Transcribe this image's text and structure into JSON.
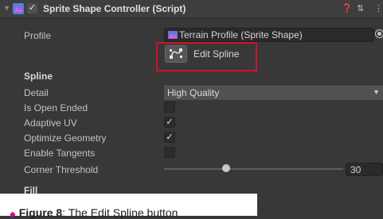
{
  "header": {
    "title": "Sprite Shape Controller (Script)",
    "enabled": true,
    "help_icon": "help-icon",
    "preset_icon": "preset-icon",
    "menu_icon": "kebab-menu-icon"
  },
  "profile": {
    "label": "Profile",
    "value": "Terrain Profile (Sprite Shape)"
  },
  "edit_spline": {
    "label": "Edit Spline"
  },
  "spline": {
    "section": "Spline",
    "detail_label": "Detail",
    "detail_value": "High Quality",
    "is_open_ended_label": "Is Open Ended",
    "is_open_ended": false,
    "adaptive_uv_label": "Adaptive UV",
    "adaptive_uv": true,
    "optimize_geometry_label": "Optimize Geometry",
    "optimize_geometry": true,
    "enable_tangents_label": "Enable Tangents",
    "enable_tangents": false,
    "corner_threshold_label": "Corner Threshold",
    "corner_threshold_value": "30"
  },
  "fill": {
    "section": "Fill"
  },
  "caption": {
    "prefix": "Figure 8",
    "text": ": The Edit Spline button"
  },
  "colors": {
    "highlight": "#d5102a",
    "caption_marker": "#e6007e",
    "panel_bg": "#383838"
  },
  "checkmark": "✓"
}
